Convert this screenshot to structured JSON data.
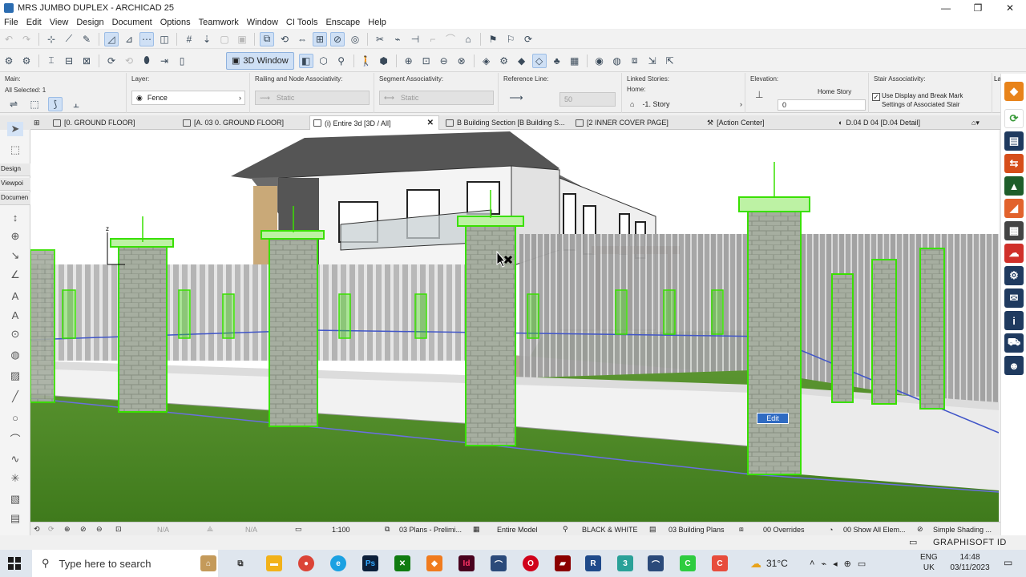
{
  "window": {
    "title": "MRS JUMBO DUPLEX - ARCHICAD 25",
    "minimize": "—",
    "maximize": "❐",
    "close": "✕"
  },
  "menu": [
    "File",
    "Edit",
    "View",
    "Design",
    "Document",
    "Options",
    "Teamwork",
    "Window",
    "CI Tools",
    "Enscape",
    "Help"
  ],
  "toolbar": {
    "window_3d_label": "3D Window"
  },
  "infobox": {
    "main": {
      "label": "Main:",
      "all_selected": "All Selected: 1"
    },
    "layer": {
      "label": "Layer:",
      "value": "Fence"
    },
    "railing_node": {
      "label": "Railing and Node Associativity:",
      "value": "Static"
    },
    "segment": {
      "label": "Segment Associativity:",
      "value": "Static"
    },
    "reference_line": {
      "label": "Reference Line:",
      "value": "50"
    },
    "linked_stories": {
      "label": "Linked Stories:",
      "home_label": "Home:",
      "home_value": "-1. Story"
    },
    "elevation": {
      "label": "Elevation:",
      "home_story": "Home Story",
      "value": "0"
    },
    "stair": {
      "label": "Stair Associativity:",
      "checkbox_text_1": "Use Display and Break Mark",
      "checkbox_text_2": "Settings of Associated Stair"
    },
    "more": "La"
  },
  "tabs": [
    {
      "label": "[0. GROUND FLOOR]"
    },
    {
      "label": "[A. 03 0. GROUND FLOOR]"
    },
    {
      "label": "(i) Entire 3d [3D / All]",
      "close": "✕"
    },
    {
      "label": "B Building Section [B Building S..."
    },
    {
      "label": "[2 INNER COVER PAGE]"
    },
    {
      "label": "[Action Center]"
    },
    {
      "label": "D.04 D 04 [D.04 Detail]"
    }
  ],
  "toolbox": {
    "design": "Design",
    "viewpoint": "Viewpoi",
    "document": "Documen"
  },
  "viewport": {
    "edit_chip": "Edit",
    "axis_label": "z"
  },
  "statusbar": {
    "na1": "N/A",
    "na2": "N/A",
    "scale": "1:100",
    "layer_combo": "03 Plans - Prelimi...",
    "model_view": "Entire Model",
    "pen_set": "BLACK & WHITE",
    "building_plans": "03 Building Plans",
    "overrides": "00 Overrides",
    "show_all": "00 Show All Elem...",
    "shading": "Simple Shading ..."
  },
  "brand": "GRAPHISOFT ID",
  "taskbar": {
    "search_placeholder": "Type here to search",
    "weather": "31°C",
    "lang_1": "ENG",
    "lang_2": "UK",
    "time": "14:48",
    "date": "03/11/2023"
  },
  "colors": {
    "accent": "#2f6bc2",
    "selection_green": "#39e000",
    "grass": "#4a8a22"
  }
}
